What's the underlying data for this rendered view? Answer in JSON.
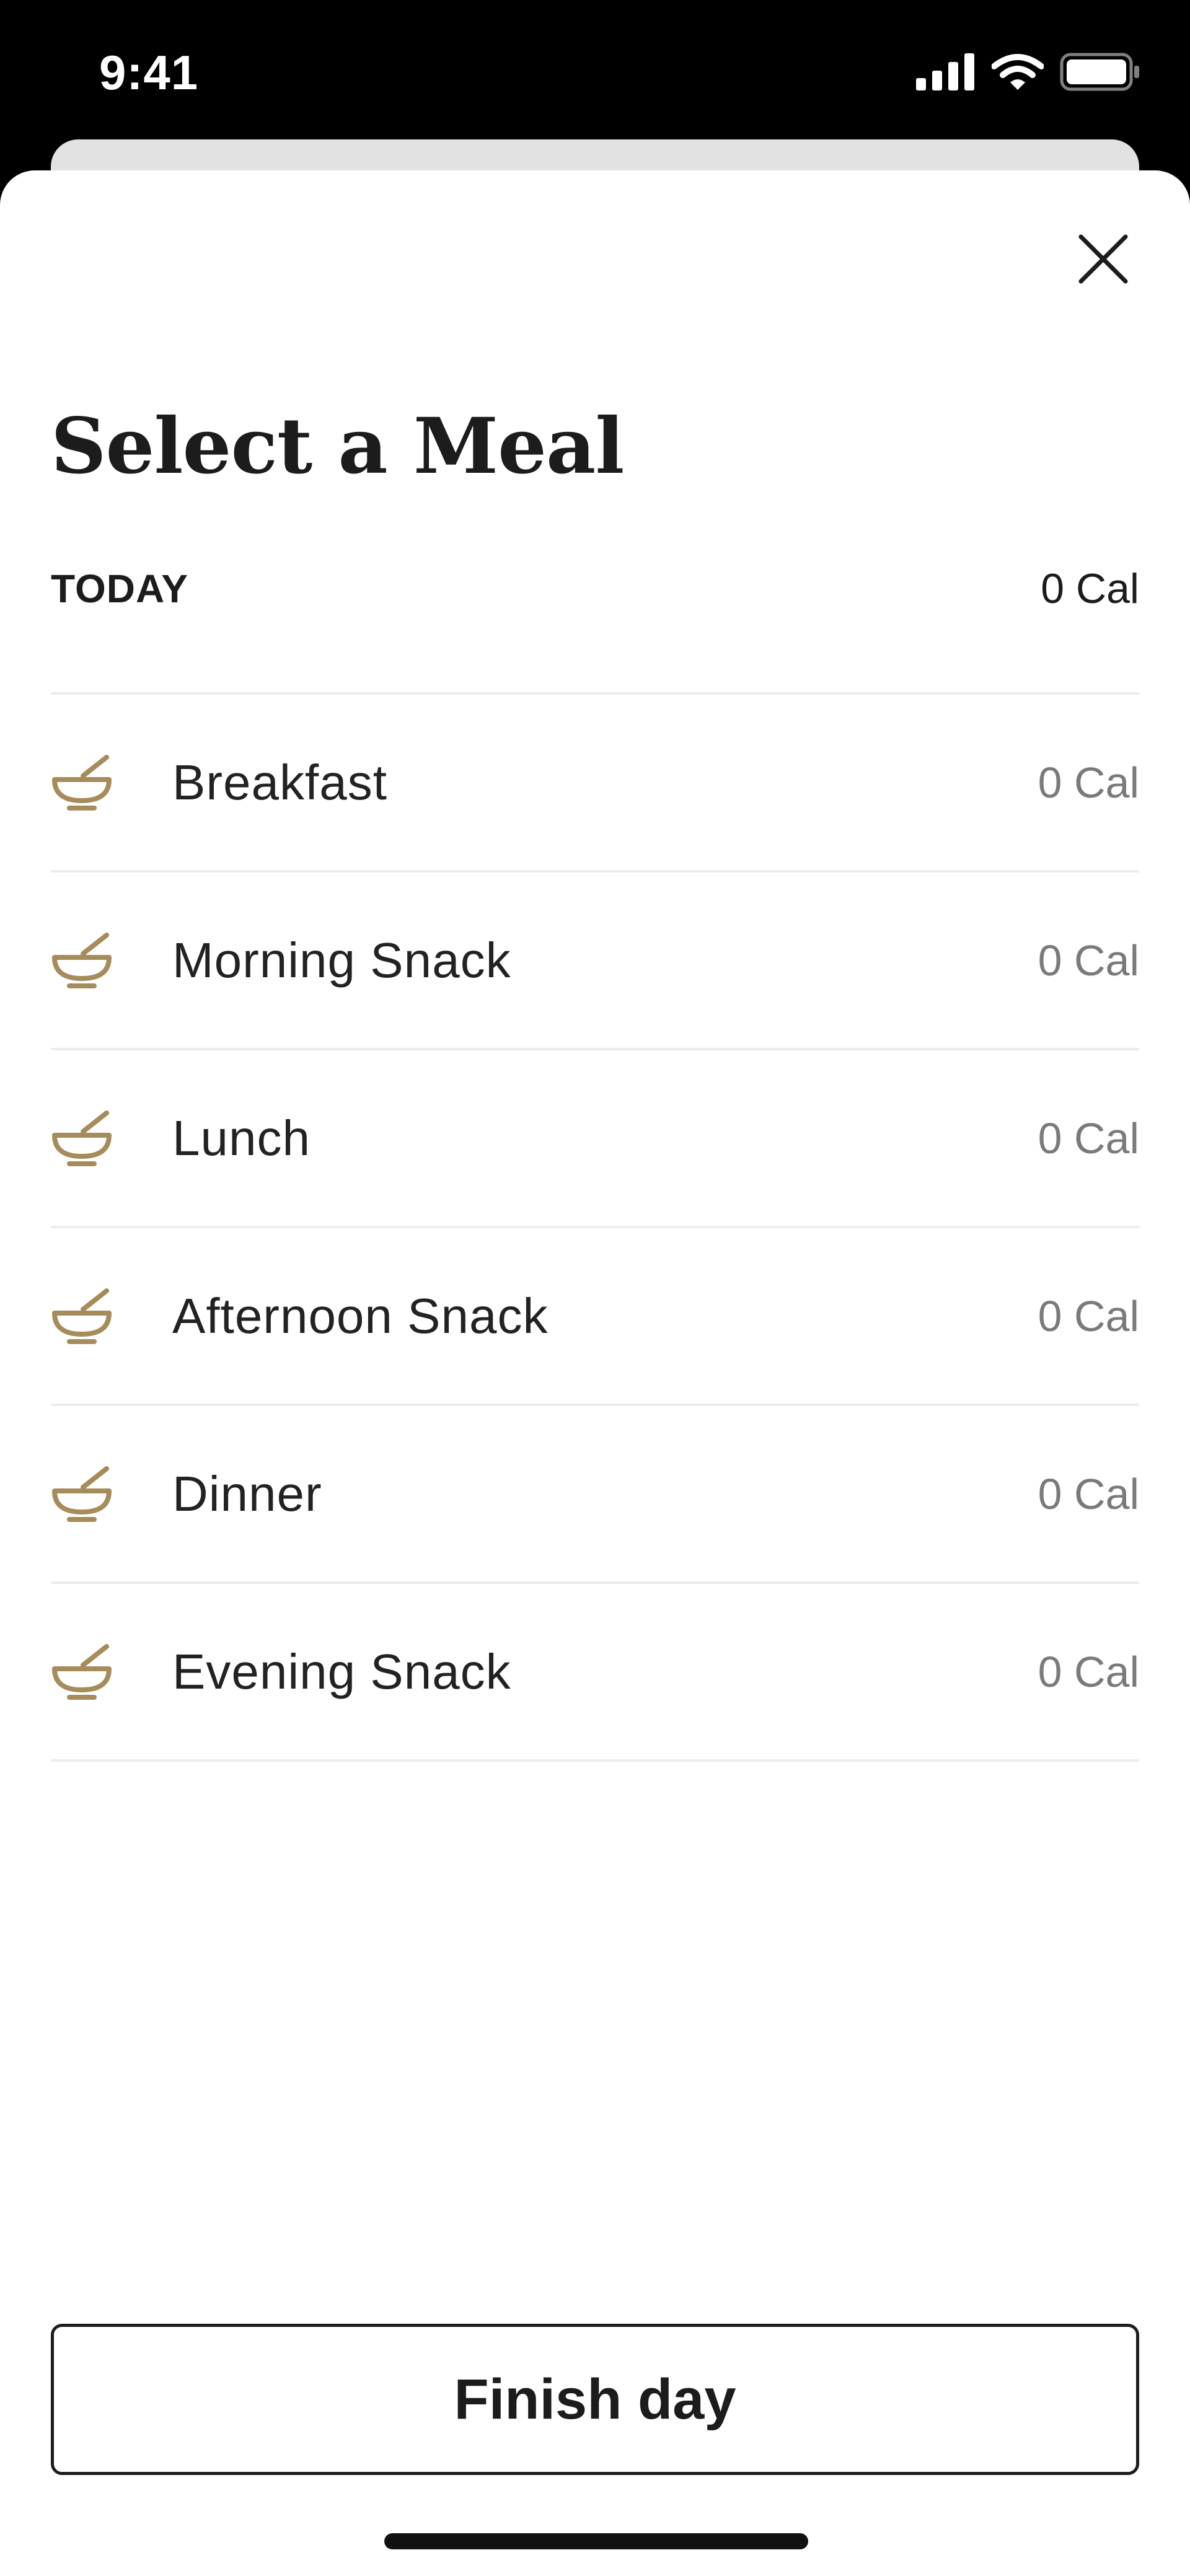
{
  "status_bar": {
    "time": "9:41",
    "icons": [
      "signal-icon",
      "wifi-icon",
      "battery-icon"
    ]
  },
  "header": {
    "close_icon": "close-icon",
    "title": "Select a Meal"
  },
  "summary": {
    "label": "TODAY",
    "total": "0 Cal"
  },
  "meals": [
    {
      "name": "Breakfast",
      "calories": "0 Cal",
      "icon": "bowl-icon"
    },
    {
      "name": "Morning Snack",
      "calories": "0 Cal",
      "icon": "bowl-icon"
    },
    {
      "name": "Lunch",
      "calories": "0 Cal",
      "icon": "bowl-icon"
    },
    {
      "name": "Afternoon Snack",
      "calories": "0 Cal",
      "icon": "bowl-icon"
    },
    {
      "name": "Dinner",
      "calories": "0 Cal",
      "icon": "bowl-icon"
    },
    {
      "name": "Evening Snack",
      "calories": "0 Cal",
      "icon": "bowl-icon"
    }
  ],
  "footer": {
    "finish_label": "Finish day"
  },
  "colors": {
    "accent_gold": "#a68c5a",
    "text_dark": "#1c1c1c",
    "text_muted": "#7a7a7a",
    "divider": "#ececec"
  }
}
